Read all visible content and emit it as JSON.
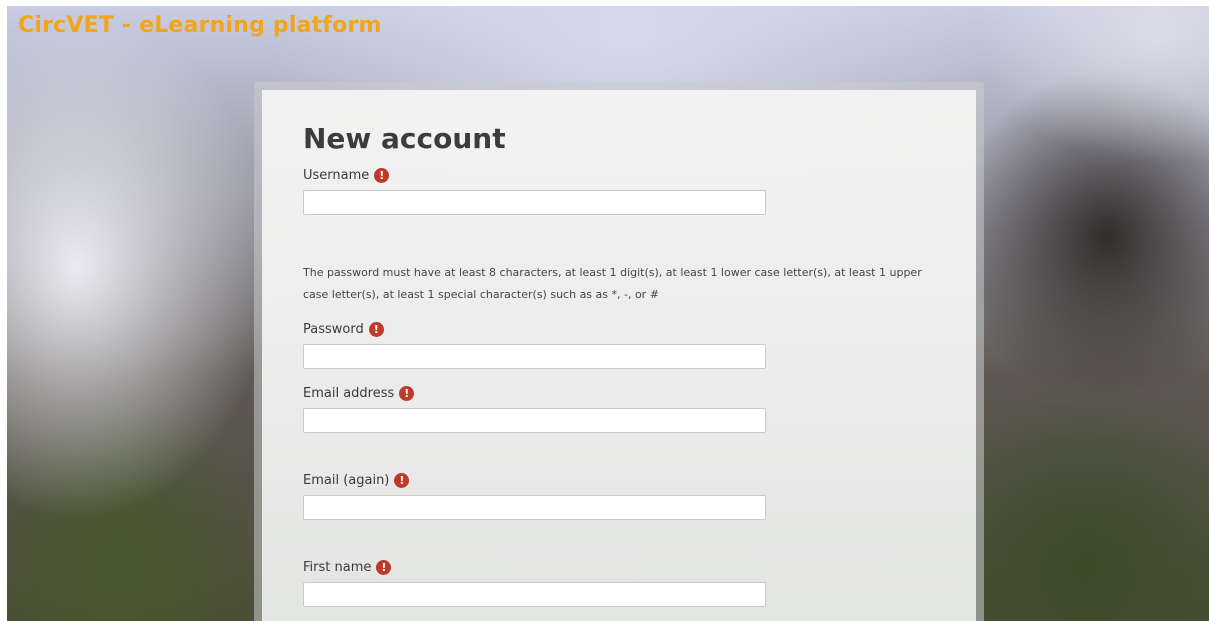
{
  "site": {
    "title": "CircVET - eLearning platform"
  },
  "form": {
    "heading": "New account",
    "password_policy": "The password must have at least 8 characters, at least 1 digit(s), at least 1 lower case letter(s), at least 1 upper case letter(s), at least 1 special character(s) such as as *, -, or #",
    "required_icon": "exclamation-circle-icon",
    "required_icon_glyph": "!",
    "required_color": "#c0392b",
    "fields": {
      "username": {
        "label": "Username",
        "value": ""
      },
      "password": {
        "label": "Password",
        "value": ""
      },
      "email": {
        "label": "Email address",
        "value": ""
      },
      "email_again": {
        "label": "Email (again)",
        "value": ""
      },
      "first_name": {
        "label": "First name",
        "value": ""
      }
    }
  },
  "colors": {
    "brand": "#f0a51a",
    "heading": "#3c3c3c"
  }
}
